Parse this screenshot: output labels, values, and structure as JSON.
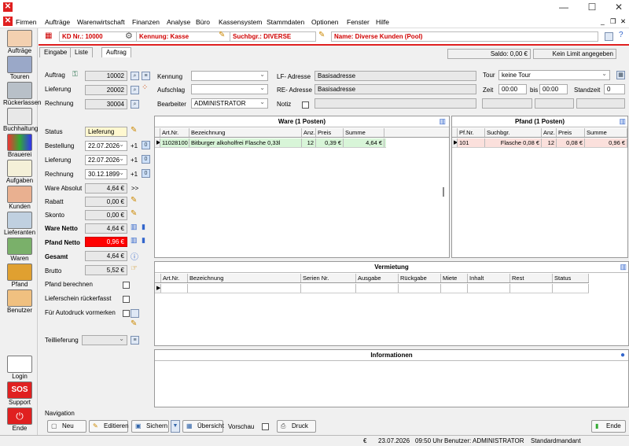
{
  "window": {
    "minimize": "—",
    "maximize": "☐",
    "close": "✕"
  },
  "menu": [
    "Firmen",
    "Aufträge",
    "Warenwirtschaft",
    "Finanzen",
    "Analyse",
    "Büro",
    "Kassensystem",
    "Stammdaten",
    "Optionen",
    "Fenster",
    "Hilfe"
  ],
  "mdi": {
    "min": "_",
    "restore": "❐",
    "close": "✕"
  },
  "sidebar": [
    "Aufträge",
    "Touren",
    "Rückerlassen",
    "Buchhaltung",
    "Brauerei",
    "Aufgaben",
    "Kunden",
    "Lieferanten",
    "Waren",
    "Pfand",
    "Benutzer"
  ],
  "sidebar_bottom": [
    "Login",
    "Support",
    "Ende"
  ],
  "sos": "SOS",
  "header": {
    "kd": "KD Nr.: 10000",
    "kennung": "Kennung: Kasse",
    "suchbgr": "Suchbgr.: DIVERSE",
    "name": "Name: Diverse Kunden (Pool)"
  },
  "tabs": [
    "Eingabe",
    "Liste",
    "Auftrag"
  ],
  "saldo": "Saldo: 0,00 €",
  "limit": "Kein Limit angegeben",
  "left": {
    "auftrag_label": "Auftrag",
    "auftrag": "10002",
    "lieferung_label": "Lieferung",
    "lieferung": "20002",
    "rechnung_label": "Rechnung",
    "rechnung": "30004",
    "status_label": "Status",
    "status": "Lieferung",
    "bestellung_label": "Bestellung",
    "bestellung": "22.07.2026",
    "lief_label": "Lieferung",
    "lief_date": "22.07.2026",
    "rech_label": "Rechnung",
    "rech_date": "30.12.1899",
    "plus1": "+1",
    "ware_abs_label": "Ware Absolut",
    "ware_abs": "4,64 €",
    "ware_abs_arrow": ">>",
    "rabatt_label": "Rabatt",
    "rabatt": "0,00 €",
    "skonto_label": "Skonto",
    "skonto": "0,00 €",
    "ware_netto_label": "Ware Netto",
    "ware_netto": "4,64 €",
    "pfand_netto_label": "Pfand Netto",
    "pfand_netto": "0,96 €",
    "gesamt_label": "Gesamt",
    "gesamt": "4,64 €",
    "brutto_label": "Brutto",
    "brutto": "5,52 €",
    "pfand_ber": "Pfand berechnen",
    "lieferschein": "Lieferschein rückerfasst",
    "autodruck": "Für Autodruck vormerken",
    "teillieferung": "Teillieferung"
  },
  "mid": {
    "kennung": "Kennung",
    "aufschlag": "Aufschlag",
    "bearbeiter": "Bearbeiter",
    "bearbeiter_val": "ADMINISTRATOR",
    "lf_label": "LF- Adresse",
    "lf": "Basisadresse",
    "re_label": "RE- Adresse",
    "re": "Basisadresse",
    "notiz": "Notiz"
  },
  "right": {
    "tour_label": "Tour",
    "tour": "keine Tour",
    "zeit": "Zeit",
    "von": "00:00",
    "bis_label": "bis",
    "bis": "00:00",
    "standzeit_label": "Standzeit",
    "standzeit": "0"
  },
  "ware": {
    "title": "Ware (1 Posten)",
    "cols": [
      "Art.Nr.",
      "Bezeichnung",
      "Anz.",
      "Preis",
      "Summe"
    ],
    "rows": [
      [
        "11028100",
        "Bitburger alkoholfrei Flasche 0,33l",
        "12",
        "0,39 €",
        "4,64 €"
      ]
    ]
  },
  "pfand": {
    "title": "Pfand (1 Posten)",
    "cols": [
      "Pf.Nr.",
      "Suchbgr.",
      "Anz.",
      "Preis",
      "Summe"
    ],
    "rows": [
      [
        "101",
        "Flasche 0,08 €",
        "12",
        "0,08 €",
        "0,96 €"
      ]
    ]
  },
  "verm": {
    "title": "Vermietung",
    "cols": [
      "Art.Nr.",
      "Bezeichnung",
      "Serien Nr.",
      "Ausgabe",
      "Rückgabe",
      "Miete",
      "Inhalt",
      "Rest",
      "Status"
    ]
  },
  "info": {
    "title": "Informationen"
  },
  "nav": {
    "label": "Navigation",
    "neu": "Neu",
    "edit": "Editieren",
    "save": "Sichern",
    "overview": "Übersicht",
    "preview": "Vorschau",
    "print": "Druck",
    "end": "Ende"
  },
  "status": {
    "euro": "€",
    "date": "23.07.2026",
    "time": "09:50 Uhr",
    "user": "Benutzer: ADMINISTRATOR",
    "mandant": "Standardmandant"
  },
  "colors": {
    "accent": "#e02020",
    "pfand_red": "#ff0000",
    "ware_row": "#d8f5d8",
    "pfand_row": "#fbe0dc"
  }
}
